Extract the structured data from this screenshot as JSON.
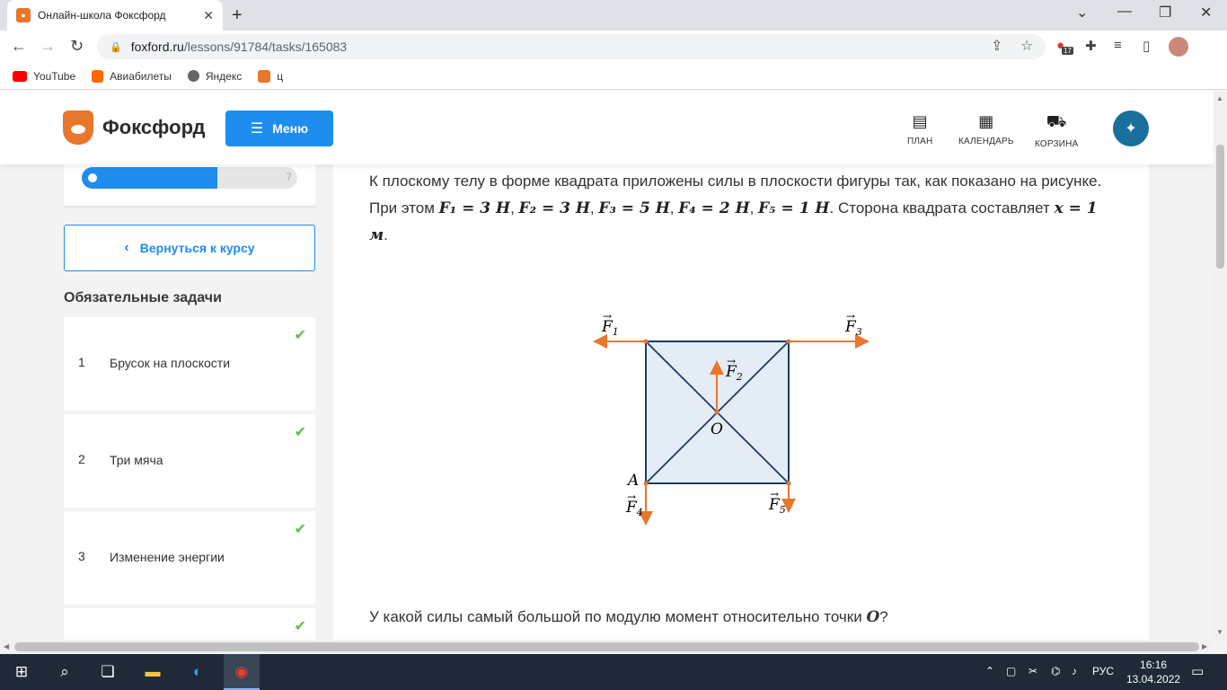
{
  "browser": {
    "tab_title": "Онлайн-школа Фоксфорд",
    "tab_favicon": "fox-favicon",
    "url_host": "foxford.ru",
    "url_path": "/lessons/91784/tasks/165083",
    "extension_badge": "17",
    "bookmarks": [
      {
        "label": "YouTube",
        "icon": "youtube-icon",
        "color": "#ff0000"
      },
      {
        "label": "Авиабилеты",
        "icon": "aviasales-icon",
        "color": "#ff6a00"
      },
      {
        "label": "Яндекс",
        "icon": "globe-icon",
        "color": "#555555"
      },
      {
        "label": "ц",
        "icon": "fox-icon",
        "color": "#e8762b"
      }
    ]
  },
  "header": {
    "logo_text": "Фоксфорд",
    "menu_label": "Меню",
    "nav": [
      {
        "label": "ПЛАН",
        "icon": "plan-icon"
      },
      {
        "label": "КАЛЕНДАРЬ",
        "icon": "calendar-icon"
      },
      {
        "label": "КОРЗИНА",
        "icon": "cart-icon"
      }
    ],
    "brand_color": "#1f8ded",
    "accent_color": "#e8762b"
  },
  "sidebar": {
    "progress": {
      "completed_fraction": 0.63,
      "total": "7"
    },
    "back_label": "Вернуться к курсу",
    "tasks_title": "Обязательные задачи",
    "tasks": [
      {
        "num": "1",
        "title": "Брусок на плоскости",
        "done": true
      },
      {
        "num": "2",
        "title": "Три мяча",
        "done": true
      },
      {
        "num": "3",
        "title": "Изменение энергии",
        "done": true
      },
      {
        "num": "",
        "title": "",
        "done": true
      }
    ]
  },
  "task": {
    "text_1": "К  плоскому телу в форме квадрата приложены силы в плоскости фигуры так, как показано на рисунке. При этом ",
    "f1": "F₁ = 3 Н",
    "f2": "F₂ = 3 Н",
    "f3": "F₃ = 5 Н",
    "f4": "F₄ = 2 Н",
    "f5": "F₅ = 1 Н",
    "text_2": ". Сторона квадрата составляет ",
    "side": "x = 1 м",
    "text_3": ".",
    "question_1": "У какой силы самый большой по модулю момент относительно точки ",
    "question_point": "O",
    "question_2": "?",
    "figure": {
      "labels": {
        "F1": "F",
        "F2": "F",
        "F3": "F",
        "F4": "F",
        "F5": "F",
        "O": "O",
        "A": "A"
      },
      "subscripts": {
        "F1": "1",
        "F2": "2",
        "F3": "3",
        "F4": "4",
        "F5": "5"
      },
      "arrow_color": "#e8762b",
      "square_fill": "#e4ecf6",
      "square_stroke": "#1d3b66"
    }
  },
  "taskbar": {
    "language": "РУС",
    "time": "16:16",
    "date": "13.04.2022"
  }
}
